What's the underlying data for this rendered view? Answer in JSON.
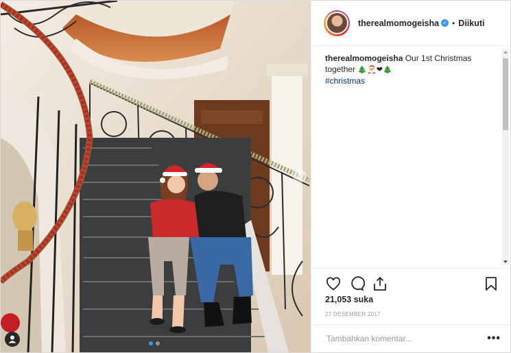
{
  "post": {
    "username": "therealmomogeisha",
    "separator": "•",
    "follow_status": "Diikuti",
    "caption": {
      "username": "therealmomogeisha",
      "text": "Our 1st Christmas together",
      "emojis": "🎄🎅❤🎄",
      "hashtag": "#christmas"
    },
    "likes": "21,053 suka",
    "date": "27 DESEMBER 2017",
    "comment_placeholder": "Tambahkan komentar...",
    "more_options": "•••"
  },
  "icons": {
    "avatar": "profile-avatar",
    "verified": "verified-badge-icon",
    "like": "heart-icon",
    "comment": "comment-bubble-icon",
    "share": "share-icon",
    "save": "bookmark-icon",
    "tag": "user-tag-icon"
  },
  "colors": {
    "accent_blue": "#3897f0",
    "hashtag": "#003569",
    "border": "#dbdbdb",
    "muted_text": "#999999"
  }
}
